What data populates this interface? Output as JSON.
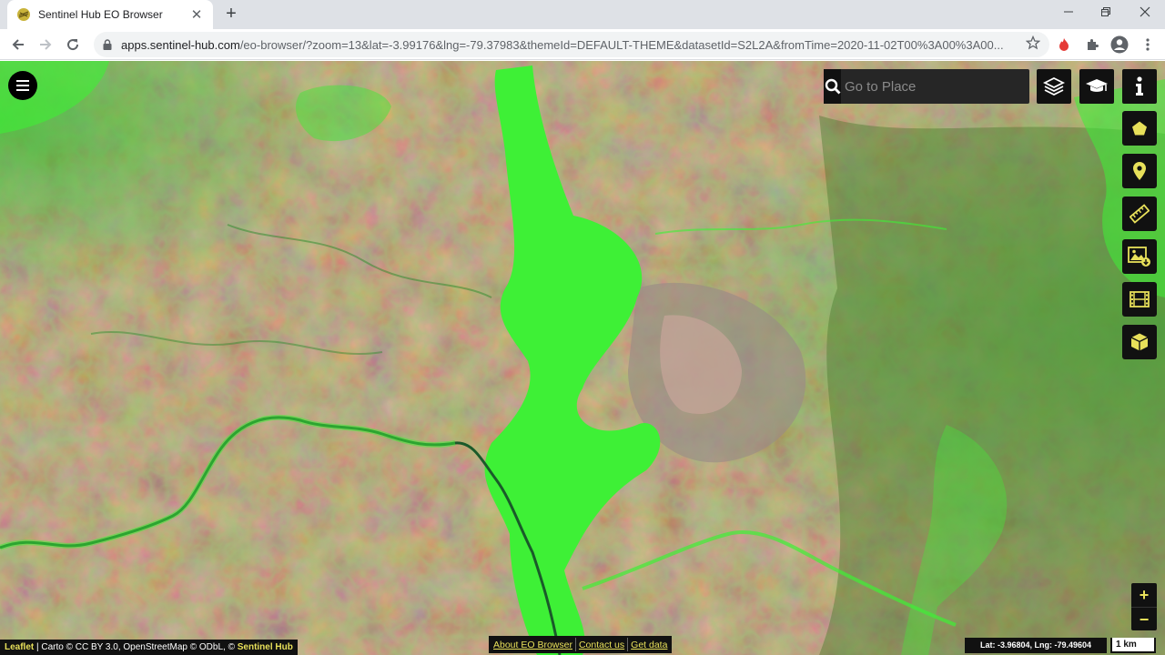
{
  "browser": {
    "tab_title": "Sentinel Hub EO Browser",
    "tab_close": "✕",
    "new_tab": "+",
    "url_domain": "apps.sentinel-hub.com",
    "url_path": "/eo-browser/?zoom=13&lat=-3.99176&lng=-79.37983&themeId=DEFAULT-THEME&datasetId=S2L2A&fromTime=2020-11-02T00%3A00%3A00...",
    "window_controls": [
      "minimize",
      "restore",
      "close"
    ]
  },
  "search": {
    "placeholder": "Go to Place",
    "value": ""
  },
  "right_tools": [
    {
      "name": "aoi-polygon-icon"
    },
    {
      "name": "poi-marker-icon"
    },
    {
      "name": "measure-ruler-icon"
    },
    {
      "name": "image-download-icon"
    },
    {
      "name": "timelapse-film-icon"
    },
    {
      "name": "3d-cube-icon"
    }
  ],
  "top_tools": [
    {
      "name": "layers-icon"
    },
    {
      "name": "education-mode-icon"
    },
    {
      "name": "info-icon"
    }
  ],
  "zoom": {
    "in": "+",
    "out": "−"
  },
  "attribution": {
    "leaflet": "Leaflet",
    "rest": " | Carto © CC BY 3.0, OpenStreetMap © ODbL, © ",
    "sentinel": "Sentinel Hub"
  },
  "footer_links": [
    "About EO Browser",
    "Contact us",
    "Get data"
  ],
  "coordinates": "Lat: -3.96804, Lng: -79.49604",
  "scale": "1 km",
  "colors": {
    "accent": "#e8e05a",
    "panel": "#111111",
    "vegetation": "#3ef036",
    "soil": "#9a6040"
  }
}
